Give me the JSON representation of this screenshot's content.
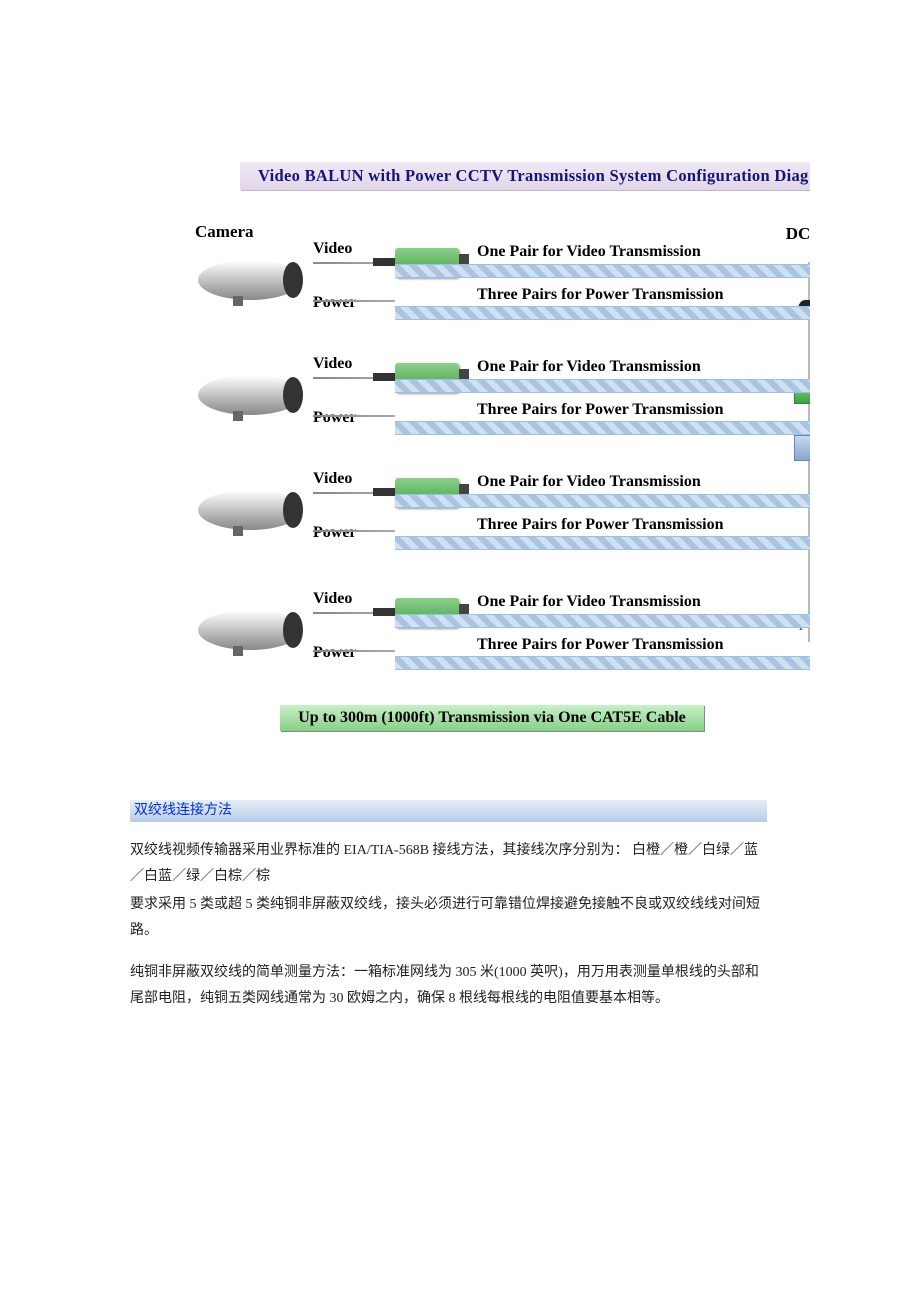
{
  "banner_title": "Video BALUN with Power CCTV Transmission System Configuration Diag",
  "labels": {
    "camera": "Camera",
    "video": "Video",
    "power": "Power",
    "dc": "DC/",
    "one_pair": "One Pair for Video Transmission",
    "three_pair": "Three Pairs for Power Transmission",
    "p": "P"
  },
  "rows": [
    {
      "video_lbl": "Video",
      "power_lbl": "Power",
      "pair1": "One Pair for Video Transmission",
      "pair3": "Three Pairs for Power Transmission"
    },
    {
      "video_lbl": "Video",
      "power_lbl": "Power",
      "pair1": "One Pair for Video Transmission",
      "pair3": "Three Pairs for Power Transmission"
    },
    {
      "video_lbl": "Video",
      "power_lbl": "Power",
      "pair1": "One Pair for Video Transmission",
      "pair3": "Three Pairs for Power Transmission"
    },
    {
      "video_lbl": "Video",
      "power_lbl": "Power",
      "pair1": "One Pair for Video Transmission",
      "pair3": "Three Pairs for Power Transmission"
    }
  ],
  "caption": "Up to 300m (1000ft) Transmission via One CAT5E Cable",
  "section_head": "双绞线连接方法",
  "paragraphs": {
    "p1": "双绞线视频传输器采用业界标准的 EIA/TIA-568B 接线方法，其接线次序分别为： 白橙／橙／白绿／蓝／白蓝／绿／白棕／棕",
    "p2": "要求采用 5 类或超 5 类纯铜非屏蔽双绞线，接头必须进行可靠错位焊接避免接触不良或双绞线线对间短路。",
    "p3": "纯铜非屏蔽双绞线的简单测量方法：一箱标准网线为 305 米(1000 英呎)，用万用表测量单根线的头部和尾部电阻，纯铜五类网线通常为 30 欧姆之内，确保 8 根线每根线的电阻值要基本相等。"
  }
}
